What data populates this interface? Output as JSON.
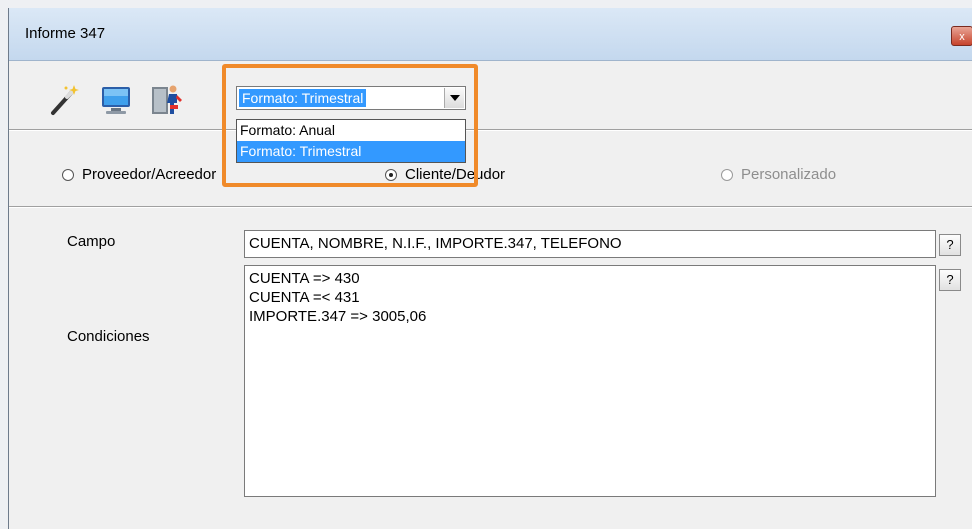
{
  "window": {
    "title": "Informe 347",
    "close_label": "x"
  },
  "toolbar": {
    "icons": [
      "magic-wand-icon",
      "monitor-icon",
      "exit-door-icon"
    ]
  },
  "format_combo": {
    "selected": "Formato: Trimestral",
    "options": [
      "Formato: Anual",
      "Formato: Trimestral"
    ],
    "selected_index": 1
  },
  "radios": [
    {
      "label": "Proveedor/Acreedor",
      "selected": false,
      "enabled": true
    },
    {
      "label": "Cliente/Deudor",
      "selected": true,
      "enabled": true
    },
    {
      "label": "Personalizado",
      "selected": false,
      "enabled": false
    }
  ],
  "campo": {
    "label": "Campo",
    "value": "CUENTA, NOMBRE, N.I.F., IMPORTE.347, TELEFONO",
    "help": "?"
  },
  "condiciones": {
    "label": "Condiciones",
    "lines": [
      "CUENTA => 430",
      "CUENTA =< 431",
      "IMPORTE.347 => 3005,06"
    ],
    "help": "?"
  },
  "colors": {
    "highlight": "#f08a2a",
    "selection": "#3399ff"
  }
}
